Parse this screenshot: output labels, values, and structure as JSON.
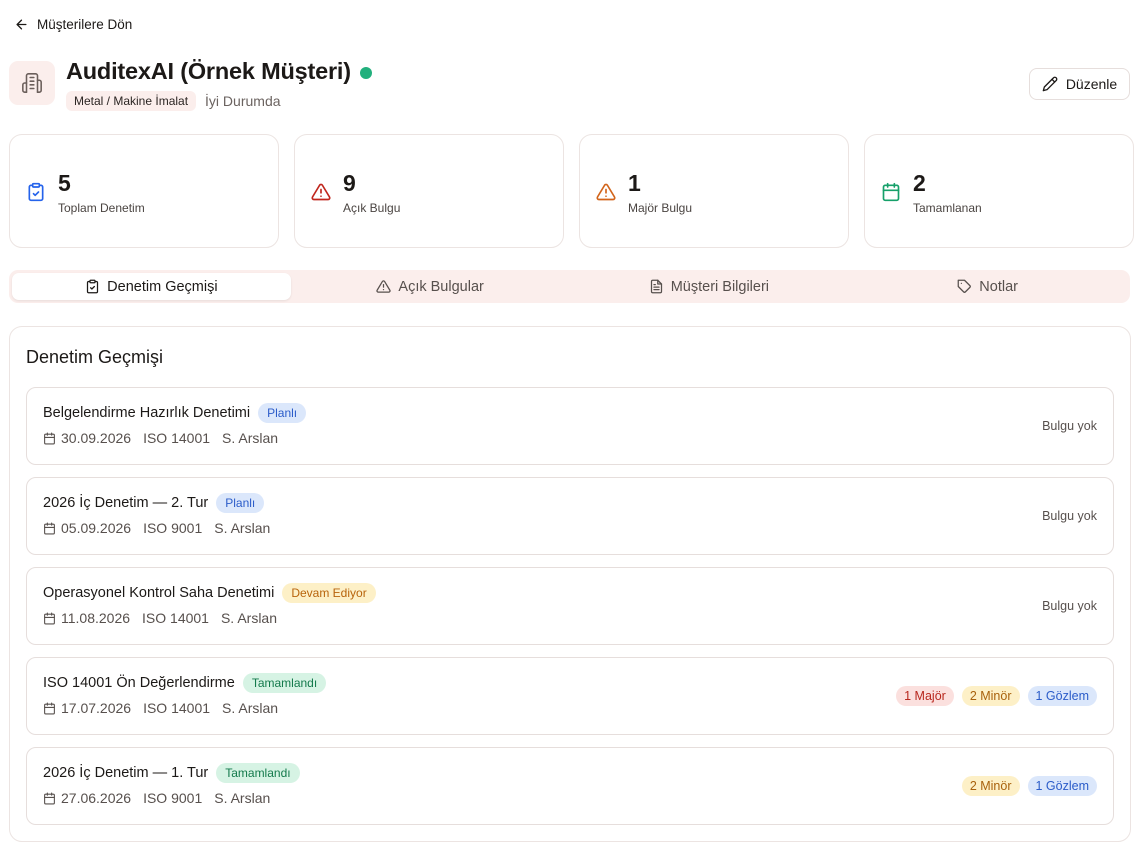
{
  "nav": {
    "back_label": "Müşterilere Dön"
  },
  "client": {
    "name": "AuditexAI (Örnek Müşteri)",
    "industry": "Metal / Makine İmalat",
    "health": "İyi Durumda",
    "status_color": "#22b07d"
  },
  "actions": {
    "edit_label": "Düzenle"
  },
  "stats": [
    {
      "value": "5",
      "label": "Toplam Denetim",
      "icon": "clipboard-check-icon",
      "color": "#2563eb"
    },
    {
      "value": "9",
      "label": "Açık Bulgu",
      "icon": "alert-triangle-icon",
      "color": "#c0261d"
    },
    {
      "value": "1",
      "label": "Majör Bulgu",
      "icon": "alert-triangle-icon",
      "color": "#d2641a"
    },
    {
      "value": "2",
      "label": "Tamamlanan",
      "icon": "calendar-icon",
      "color": "#16a06a"
    }
  ],
  "tabs": [
    {
      "label": "Denetim Geçmişi",
      "icon": "clipboard-icon",
      "active": true
    },
    {
      "label": "Açık Bulgular",
      "icon": "alert-triangle-icon",
      "active": false
    },
    {
      "label": "Müşteri Bilgileri",
      "icon": "file-text-icon",
      "active": false
    },
    {
      "label": "Notlar",
      "icon": "tag-icon",
      "active": false
    }
  ],
  "history": {
    "title": "Denetim Geçmişi",
    "audits": [
      {
        "name": "Belgelendirme Hazırlık Denetimi",
        "status": "Planlı",
        "date": "30.09.2026",
        "standard": "ISO 14001",
        "auditor": "S. Arslan",
        "findings_text": "Bulgu yok",
        "major": "",
        "minor": "",
        "observation": ""
      },
      {
        "name": "2026 İç Denetim — 2. Tur",
        "status": "Planlı",
        "date": "05.09.2026",
        "standard": "ISO 9001",
        "auditor": "S. Arslan",
        "findings_text": "Bulgu yok",
        "major": "",
        "minor": "",
        "observation": ""
      },
      {
        "name": "Operasyonel Kontrol Saha Denetimi",
        "status": "Devam Ediyor",
        "date": "11.08.2026",
        "standard": "ISO 14001",
        "auditor": "S. Arslan",
        "findings_text": "Bulgu yok",
        "major": "",
        "minor": "",
        "observation": ""
      },
      {
        "name": "ISO 14001 Ön Değerlendirme",
        "status": "Tamamlandı",
        "date": "17.07.2026",
        "standard": "ISO 14001",
        "auditor": "S. Arslan",
        "findings_text": "",
        "major": "1 Majör",
        "minor": "2 Minör",
        "observation": "1 Gözlem"
      },
      {
        "name": "2026 İç Denetim — 1. Tur",
        "status": "Tamamlandı",
        "date": "27.06.2026",
        "standard": "ISO 9001",
        "auditor": "S. Arslan",
        "findings_text": "",
        "major": "",
        "minor": "2 Minör",
        "observation": "1 Gözlem"
      }
    ]
  }
}
